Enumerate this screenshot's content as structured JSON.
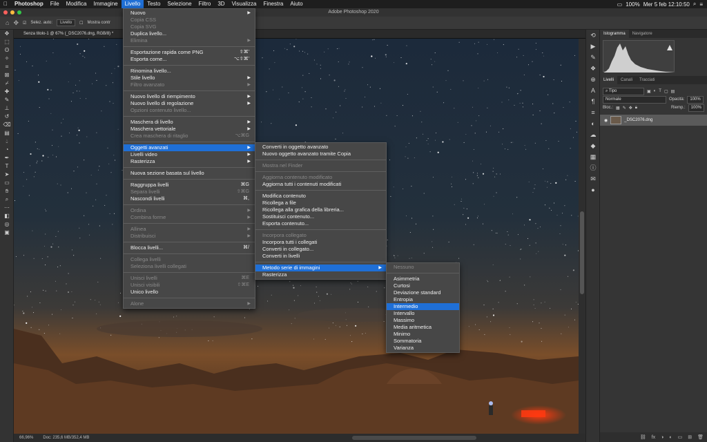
{
  "menubar": {
    "apple": "",
    "app": "Photoshop",
    "items": [
      "File",
      "Modifica",
      "Immagine",
      "Livello",
      "Testo",
      "Selezione",
      "Filtro",
      "3D",
      "Visualizza",
      "Finestra",
      "Aiuto"
    ],
    "active": "Livello",
    "battery": "100%",
    "datetime": "Mer 5 feb  12:10:50"
  },
  "window": {
    "title": "Adobe Photoshop 2020"
  },
  "options_bar": {
    "auto_select_label": "Selez. auto:",
    "layer_select": "Livello",
    "show_controls": "Mostra contr"
  },
  "document": {
    "tab_title": "Senza titolo-1 @ 67% (_DSC2076.dng, RGB/8) *"
  },
  "status": {
    "zoom": "66,96%",
    "doc_info": "Doc: 235,6 MB/352,4 MB"
  },
  "livello_menu": [
    {
      "label": "Nuovo",
      "arrow": true
    },
    {
      "label": "Copia CSS",
      "disabled": true
    },
    {
      "label": "Copia SVG",
      "disabled": true
    },
    {
      "label": "Duplica livello..."
    },
    {
      "label": "Elimina",
      "disabled": true,
      "arrow": true
    },
    {
      "sep": true
    },
    {
      "label": "Esportazione rapida come PNG",
      "shortcut": "⇧⌘'"
    },
    {
      "label": "Esporta come...",
      "shortcut": "⌥⇧⌘'"
    },
    {
      "sep": true
    },
    {
      "label": "Rinomina livello..."
    },
    {
      "label": "Stile livello",
      "arrow": true
    },
    {
      "label": "Filtro avanzato",
      "disabled": true,
      "arrow": true
    },
    {
      "sep": true
    },
    {
      "label": "Nuovo livello di riempimento",
      "arrow": true
    },
    {
      "label": "Nuovo livello di regolazione",
      "arrow": true
    },
    {
      "label": "Opzioni contenuto livello...",
      "disabled": true
    },
    {
      "sep": true
    },
    {
      "label": "Maschera di livello",
      "arrow": true
    },
    {
      "label": "Maschera vettoriale",
      "arrow": true
    },
    {
      "label": "Crea maschera di ritaglio",
      "disabled": true,
      "shortcut": "⌥⌘G"
    },
    {
      "sep": true
    },
    {
      "label": "Oggetti avanzati",
      "arrow": true,
      "highlight": true
    },
    {
      "label": "Livelli video",
      "arrow": true
    },
    {
      "label": "Rasterizza",
      "arrow": true
    },
    {
      "sep": true
    },
    {
      "label": "Nuova sezione basata sul livello"
    },
    {
      "sep": true
    },
    {
      "label": "Raggruppa livelli",
      "shortcut": "⌘G"
    },
    {
      "label": "Separa livelli",
      "disabled": true,
      "shortcut": "⇧⌘G"
    },
    {
      "label": "Nascondi livelli",
      "shortcut": "⌘,"
    },
    {
      "sep": true
    },
    {
      "label": "Ordina",
      "disabled": true,
      "arrow": true
    },
    {
      "label": "Combina forme",
      "disabled": true,
      "arrow": true
    },
    {
      "sep": true
    },
    {
      "label": "Allinea",
      "disabled": true,
      "arrow": true
    },
    {
      "label": "Distribuisci",
      "disabled": true,
      "arrow": true
    },
    {
      "sep": true
    },
    {
      "label": "Blocca livelli...",
      "shortcut": "⌘/"
    },
    {
      "sep": true
    },
    {
      "label": "Collega livelli",
      "disabled": true
    },
    {
      "label": "Seleziona livelli collegati",
      "disabled": true
    },
    {
      "sep": true
    },
    {
      "label": "Unisci livelli",
      "disabled": true,
      "shortcut": "⌘E"
    },
    {
      "label": "Unisci visibili",
      "disabled": true,
      "shortcut": "⇧⌘E"
    },
    {
      "label": "Unico livello"
    },
    {
      "sep": true
    },
    {
      "label": "Alone",
      "disabled": true,
      "arrow": true
    }
  ],
  "oggetti_menu": [
    {
      "label": "Converti in oggetto avanzato"
    },
    {
      "label": "Nuovo oggetto avanzato tramite Copia"
    },
    {
      "sep": true
    },
    {
      "label": "Mostra nel Finder",
      "disabled": true
    },
    {
      "sep": true
    },
    {
      "label": "Aggiorna contenuto modificato",
      "disabled": true
    },
    {
      "label": "Aggiorna tutti i contenuti modificati"
    },
    {
      "sep": true
    },
    {
      "label": "Modifica contenuto"
    },
    {
      "label": "Ricollega a file"
    },
    {
      "label": "Ricollega alla grafica della libreria..."
    },
    {
      "label": "Sostituisci contenuto..."
    },
    {
      "label": "Esporta contenuto..."
    },
    {
      "sep": true
    },
    {
      "label": "Incorpora collegato",
      "disabled": true
    },
    {
      "label": "Incorpora tutti i collegati"
    },
    {
      "label": "Converti in collegato..."
    },
    {
      "label": "Converti in livelli"
    },
    {
      "sep": true
    },
    {
      "label": "Metodo serie di immagini",
      "arrow": true,
      "highlight": true
    },
    {
      "label": "Rasterizza"
    }
  ],
  "metodo_menu": [
    {
      "label": "Nessuno",
      "disabled": true
    },
    {
      "sep": true
    },
    {
      "label": "Asimmetria"
    },
    {
      "label": "Curtosi"
    },
    {
      "label": "Deviazione standard"
    },
    {
      "label": "Entropia"
    },
    {
      "label": "Intermedio",
      "highlight": true
    },
    {
      "label": "Intervallo"
    },
    {
      "label": "Massimo"
    },
    {
      "label": "Media aritmetica"
    },
    {
      "label": "Minimo"
    },
    {
      "label": "Sommatoria"
    },
    {
      "label": "Varianza"
    }
  ],
  "panels": {
    "top_tabs": [
      "Istogramma",
      "Navigatore"
    ],
    "layer_tabs": [
      "Livelli",
      "Canali",
      "Tracciati"
    ],
    "filter_kind": "Tipo",
    "blend_mode": "Normale",
    "opacity_label": "Opacità:",
    "opacity_value": "100%",
    "lock_label": "Bloc.:",
    "fill_label": "Riemp.:",
    "fill_value": "100%",
    "layer_name": "_DSC2076.dng"
  }
}
